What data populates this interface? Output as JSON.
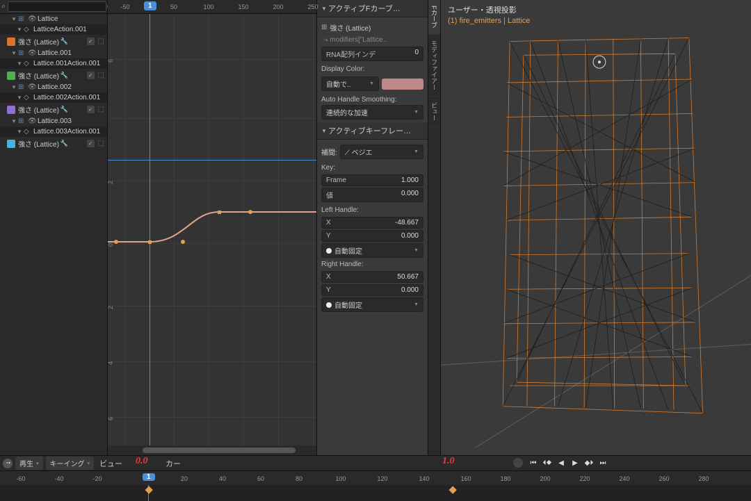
{
  "outliner": {
    "search_placeholder": "",
    "items": [
      {
        "type": "obj",
        "icon": "hash",
        "label": "Lattice",
        "chip": null
      },
      {
        "type": "action",
        "label": "LatticeAction.001"
      },
      {
        "type": "fcurve",
        "chip": "orange",
        "label": "強さ (Lattice)"
      },
      {
        "type": "obj",
        "icon": "hash",
        "label": "Lattice.001"
      },
      {
        "type": "action",
        "label": "Lattice.001Action.001"
      },
      {
        "type": "fcurve",
        "chip": "green",
        "label": "強さ (Lattice)"
      },
      {
        "type": "obj",
        "icon": "hash",
        "label": "Lattice.002"
      },
      {
        "type": "action",
        "label": "Lattice.002Action.001"
      },
      {
        "type": "fcurve",
        "chip": "purple",
        "label": "強さ (Lattice)"
      },
      {
        "type": "obj",
        "icon": "hash",
        "label": "Lattice.003"
      },
      {
        "type": "action",
        "label": "Lattice.003Action.001"
      },
      {
        "type": "fcurve",
        "chip": "cyan",
        "label": "強さ (Lattice)"
      }
    ]
  },
  "graph": {
    "ruler": [
      "-50",
      "1",
      "50",
      "100",
      "150",
      "200",
      "250"
    ],
    "current_frame": "1",
    "y_ticks": [
      "0",
      "2",
      "4",
      "6"
    ]
  },
  "props": {
    "active_fcurve_header": "アクティブFカーブ…",
    "strength_label": "強さ (Lattice)",
    "data_path": "modifiers[\"Lattice..",
    "rna_label": "RNA配列インデ",
    "rna_val": "0",
    "display_color_label": "Display Color:",
    "color_mode": "自動で.. ",
    "smoothing_label": "Auto Handle Smoothing:",
    "smoothing_val": "連続的な加速",
    "keyframe_header": "アクティブキーフレー…",
    "interp_label": "補間:",
    "interp_val": "ベジエ",
    "key_section": "Key:",
    "frame_label": "Frame",
    "frame_val": "1.000",
    "value_label": "値",
    "value_val": "0.000",
    "left_handle": "Left Handle:",
    "lh_x_label": "X",
    "lh_x": "-48.667",
    "lh_y_label": "Y",
    "lh_y": "0.000",
    "lh_mode": "自動固定",
    "right_handle": "Right Handle:",
    "rh_x_label": "X",
    "rh_x": "50.667",
    "rh_y_label": "Y",
    "rh_y": "0.000",
    "rh_mode": "自動固定"
  },
  "vtabs": [
    "Fカーブ",
    "モディファイアー",
    "ビュー"
  ],
  "viewport": {
    "title": "ユーザー・透視投影",
    "subtitle": "(1) fire_emitters | Lattice"
  },
  "bottom": {
    "play_menu": "再生",
    "keying_menu": "キーイング",
    "view_menu": "ビュー",
    "marker_menu": "カー",
    "red0": "0.0",
    "red1": "1.0"
  },
  "timeline": {
    "ticks": [
      "-60",
      "-40",
      "-20",
      "1",
      "20",
      "40",
      "60",
      "80",
      "100",
      "120",
      "140",
      "160",
      "180",
      "200",
      "220",
      "240",
      "260",
      "280"
    ],
    "current_frame": "1"
  }
}
